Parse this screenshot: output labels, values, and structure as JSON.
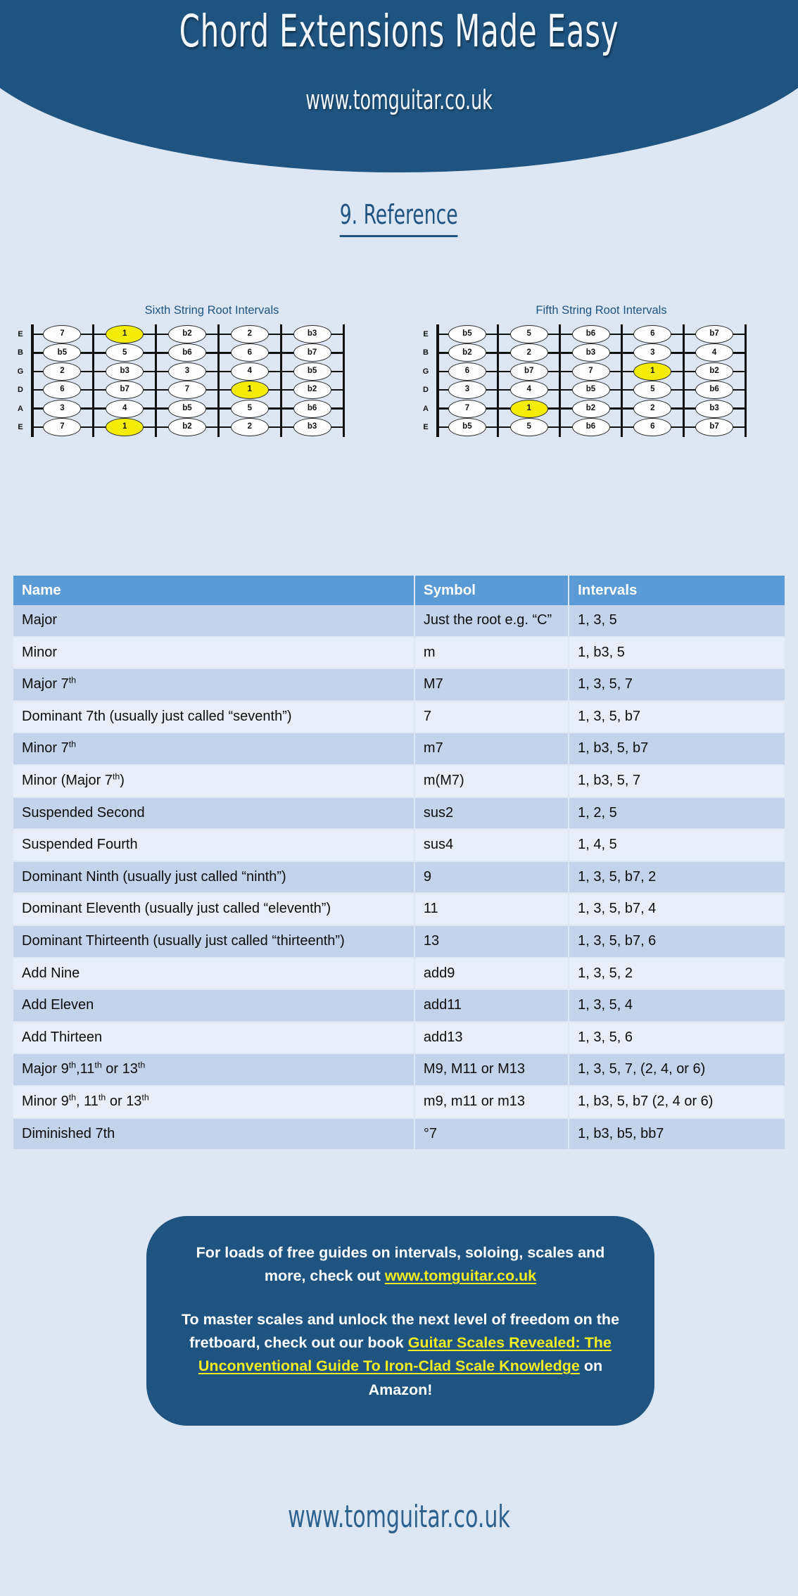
{
  "header": {
    "title": "Chord Extensions Made Easy",
    "url": "www.tomguitar.co.uk",
    "background_color": "#1f5480"
  },
  "section": {
    "title": "9. Reference"
  },
  "fretboards": [
    {
      "id": "sixth-string-root",
      "title": "Sixth String Root Intervals",
      "strings": [
        "E",
        "B",
        "G",
        "D",
        "A",
        "E"
      ],
      "root_color": "#f3eb08",
      "frets": 5,
      "rows": [
        [
          "7",
          "1",
          "b2",
          "2",
          "b3"
        ],
        [
          "b5",
          "5",
          "b6",
          "6",
          "b7"
        ],
        [
          "2",
          "b3",
          "3",
          "4",
          "b5"
        ],
        [
          "6",
          "b7",
          "7",
          "1",
          "b2"
        ],
        [
          "3",
          "4",
          "b5",
          "5",
          "b6"
        ],
        [
          "7",
          "1",
          "b2",
          "2",
          "b3"
        ]
      ],
      "roots": [
        [
          0,
          1
        ],
        [
          3,
          3
        ],
        [
          5,
          1
        ]
      ]
    },
    {
      "id": "fifth-string-root",
      "title": "Fifth String Root Intervals",
      "strings": [
        "E",
        "B",
        "G",
        "D",
        "A",
        "E"
      ],
      "root_color": "#f3eb08",
      "frets": 5,
      "rows": [
        [
          "b5",
          "5",
          "b6",
          "6",
          "b7"
        ],
        [
          "b2",
          "2",
          "b3",
          "3",
          "4"
        ],
        [
          "6",
          "b7",
          "7",
          "1",
          "b2"
        ],
        [
          "3",
          "4",
          "b5",
          "5",
          "b6"
        ],
        [
          "7",
          "1",
          "b2",
          "2",
          "b3"
        ],
        [
          "b5",
          "5",
          "b6",
          "6",
          "b7"
        ]
      ],
      "roots": [
        [
          2,
          3
        ],
        [
          4,
          1
        ]
      ]
    }
  ],
  "table": {
    "header_color": "#5b9bd5",
    "columns": [
      "Name",
      "Symbol",
      "Intervals"
    ],
    "rows": [
      {
        "name": "Major",
        "name_sup": "",
        "symbol": "Just the root e.g. “C”",
        "intervals": "1, 3, 5"
      },
      {
        "name": "Minor",
        "name_sup": "",
        "symbol": "m",
        "intervals": "1, b3, 5"
      },
      {
        "name": "Major 7",
        "name_sup": "th",
        "symbol": "M7",
        "intervals": "1, 3, 5, 7"
      },
      {
        "name": "Dominant 7th (usually  just called “seventh”)",
        "name_sup": "",
        "symbol": "7",
        "intervals": "1, 3, 5, b7"
      },
      {
        "name": "Minor 7",
        "name_sup": "th",
        "symbol": "m7",
        "intervals": "1, b3, 5, b7"
      },
      {
        "name": "Minor (Major 7",
        "name_sup": "th",
        "name_tail": ")",
        "symbol": "m(M7)",
        "intervals": "1, b3, 5, 7"
      },
      {
        "name": "Suspended Second",
        "name_sup": "",
        "symbol": "sus2",
        "intervals": "1, 2, 5"
      },
      {
        "name": "Suspended Fourth",
        "name_sup": "",
        "symbol": "sus4",
        "intervals": "1, 4, 5"
      },
      {
        "name": "Dominant Ninth (usually just called “ninth”)",
        "name_sup": "",
        "symbol": "9",
        "intervals": "1, 3, 5, b7, 2"
      },
      {
        "name": "Dominant Eleventh (usually just called “eleventh”)",
        "name_sup": "",
        "symbol": "11",
        "intervals": "1, 3, 5, b7, 4"
      },
      {
        "name": "Dominant Thirteenth (usually just called “thirteenth”)",
        "name_sup": "",
        "symbol": "13",
        "intervals": "1, 3, 5, b7, 6"
      },
      {
        "name": "Add Nine",
        "name_sup": "",
        "symbol": "add9",
        "intervals": "1, 3, 5, 2"
      },
      {
        "name": "Add Eleven",
        "name_sup": "",
        "symbol": "add11",
        "intervals": "1, 3, 5, 4"
      },
      {
        "name": "Add Thirteen",
        "name_sup": "",
        "symbol": "add13",
        "intervals": "1, 3, 5, 6"
      },
      {
        "name": "Major 9",
        "name_sup": "th",
        "name_mid": ",11",
        "name_sup2": "th",
        "name_mid2": " or 13",
        "name_sup3": "th",
        "symbol": "M9, M11 or M13",
        "intervals": "1, 3, 5, 7, (2, 4, or 6)"
      },
      {
        "name": "Minor 9",
        "name_sup": "th",
        "name_mid": ", 11",
        "name_sup2": "th",
        "name_mid2": " or 13",
        "name_sup3": "th",
        "symbol": "m9, m11 or m13",
        "intervals": "1, b3, 5, b7 (2, 4 or 6)"
      },
      {
        "name": "Diminished  7th",
        "name_sup": "",
        "symbol": "°7",
        "intervals": "1, b3, b5, bb7"
      }
    ]
  },
  "callout": {
    "background_color": "#1f5480",
    "link_color": "#f2ec20",
    "paragraph1_pre": "For loads of free guides on intervals, soloing, scales and more, check out ",
    "paragraph1_link": "www.tomguitar.co.uk",
    "paragraph2_pre": "To master scales and unlock the next level of freedom on the fretboard, check out our book ",
    "paragraph2_link": "Guitar Scales Revealed: The Unconventional Guide To Iron-Clad Scale Knowledge",
    "paragraph2_post": " on Amazon!"
  },
  "footer": {
    "url": "www.tomguitar.co.uk"
  }
}
